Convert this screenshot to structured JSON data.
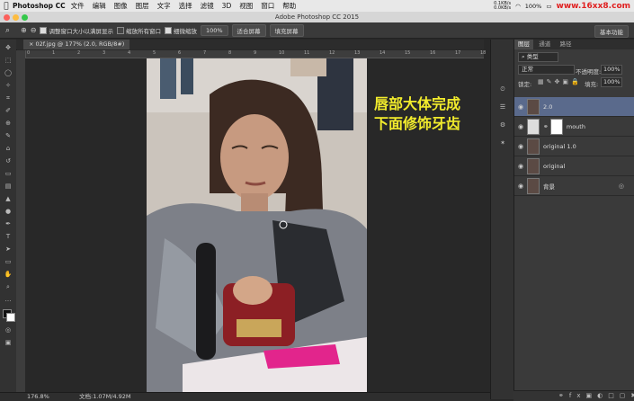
{
  "menubar": {
    "app_name": "Photoshop CC",
    "items": [
      "文件",
      "编辑",
      "图像",
      "图层",
      "文字",
      "选择",
      "滤镜",
      "3D",
      "视图",
      "窗口",
      "帮助"
    ],
    "net_up": "0.1KB/s",
    "net_down": "0.0KB/s",
    "battery": "100%",
    "watermark": "www.16xx8.com"
  },
  "window": {
    "title": "Adobe Photoshop CC 2015"
  },
  "options": {
    "checkbox1": "调整窗口大小以满屏显示",
    "checkbox2": "缩放所有窗口",
    "checkbox3": "细微缩放",
    "zoom_value": "100%",
    "fit_screen": "适合屏幕",
    "fill_screen": "填充屏幕",
    "workspace": "基本功能"
  },
  "document": {
    "tab_label": "02f.jpg @ 177% (2.0, RGB/8#)",
    "ruler_marks": [
      "0",
      "1",
      "2",
      "3",
      "4",
      "5",
      "6",
      "7",
      "8",
      "9",
      "10",
      "11",
      "12",
      "13",
      "14",
      "15",
      "16",
      "17",
      "18"
    ]
  },
  "overlay": {
    "line1": "唇部大体完成",
    "line2": "下面修饰牙齿",
    "color": "#f2ec2c"
  },
  "status": {
    "zoom": "176.8%",
    "doc_size": "文档:1.07M/4.92M"
  },
  "layers_panel": {
    "tabs": [
      "图层",
      "通道",
      "路径"
    ],
    "filter_kind": "类型",
    "blend_mode": "正常",
    "opacity_label": "不透明度:",
    "opacity_value": "100%",
    "lock_label": "锁定:",
    "fill_label": "填充:",
    "fill_value": "100%",
    "layers": [
      {
        "name": "2.0",
        "selected": true
      },
      {
        "name": "mouth",
        "selected": false
      },
      {
        "name": "original 1.0",
        "selected": false
      },
      {
        "name": "original",
        "selected": false
      },
      {
        "name": "背景",
        "selected": false
      }
    ]
  }
}
